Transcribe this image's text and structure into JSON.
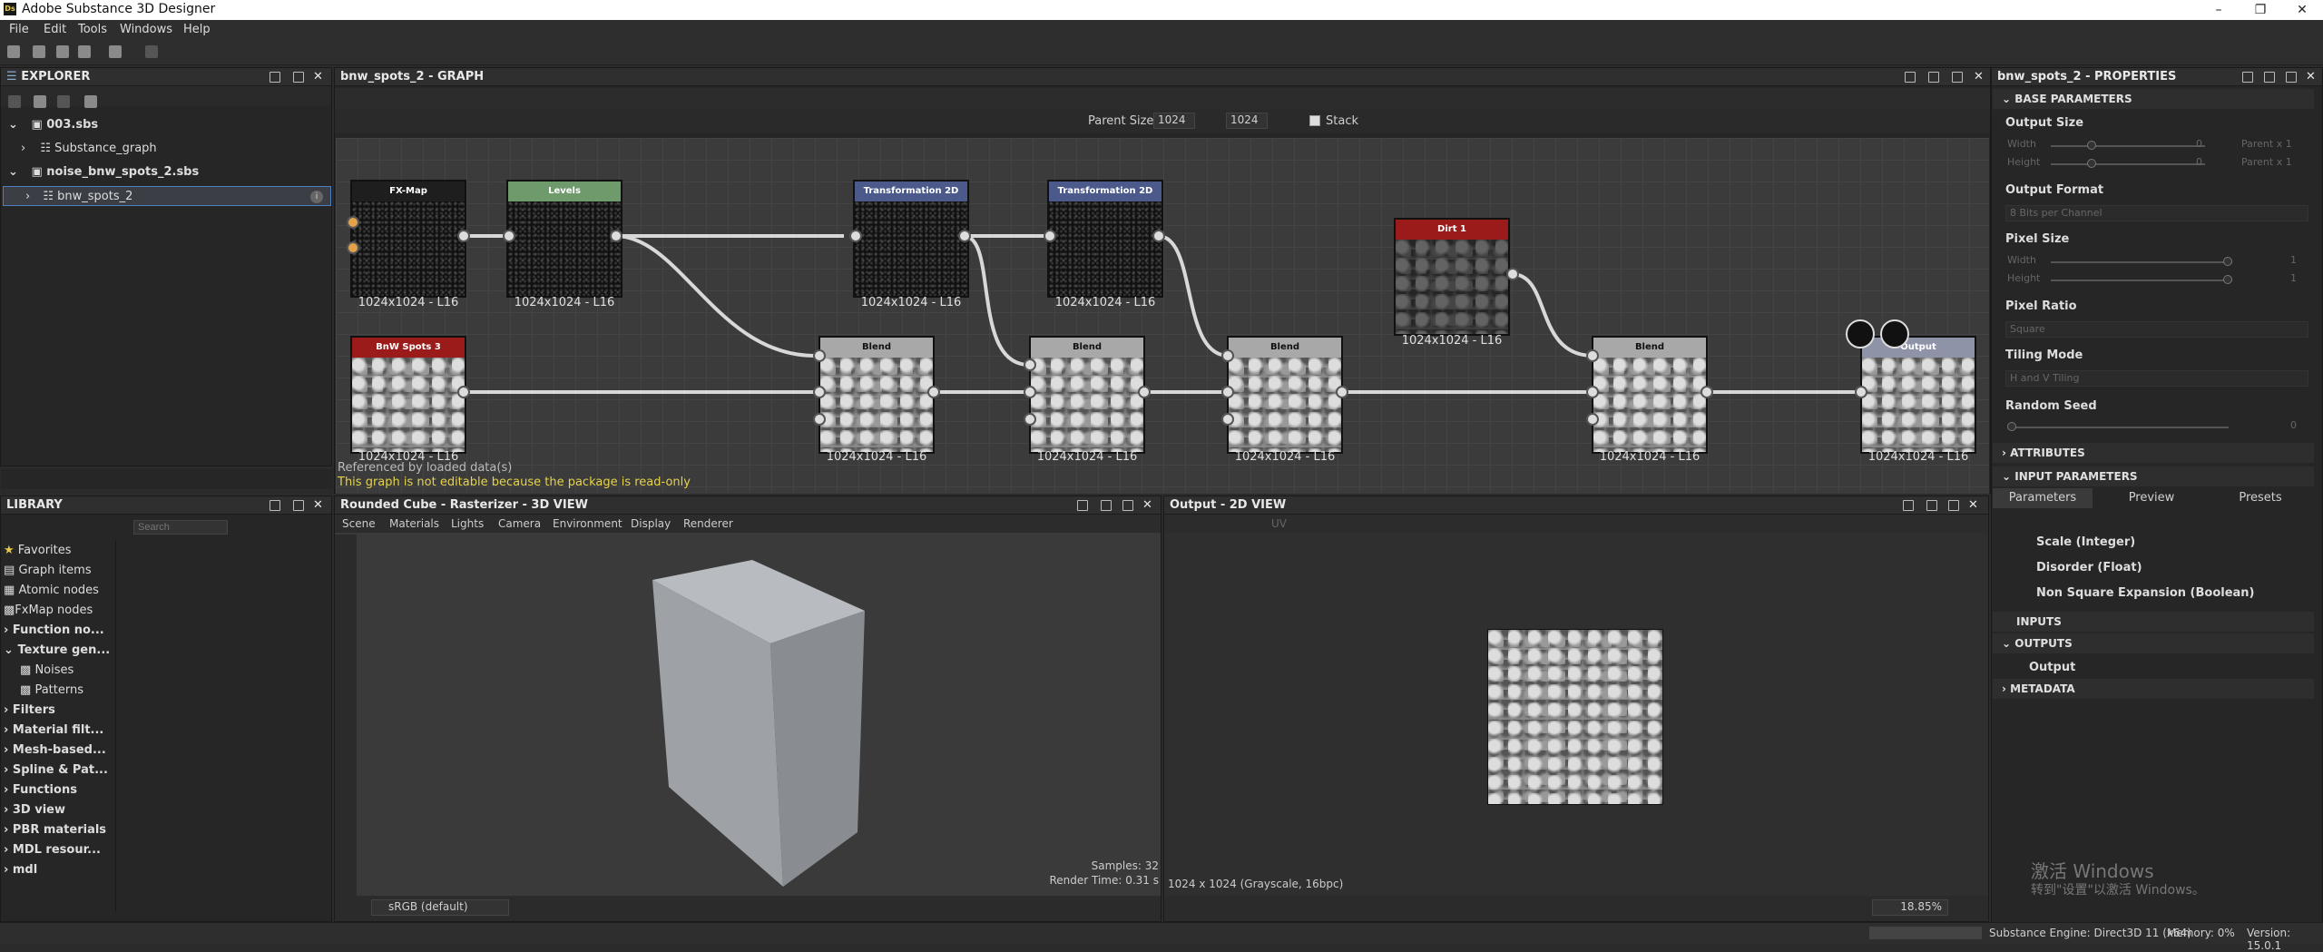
{
  "app": {
    "title": "Adobe Substance 3D Designer",
    "logo": "Ds"
  },
  "menu": [
    "File",
    "Edit",
    "Tools",
    "Windows",
    "Help"
  ],
  "explorer": {
    "title": "EXPLORER",
    "items": [
      {
        "label": "003.sbs"
      },
      {
        "label": "Substance_graph"
      },
      {
        "label": "noise_bnw_spots_2.sbs"
      },
      {
        "label": "bnw_spots_2"
      }
    ]
  },
  "graph": {
    "title": "bnw_spots_2 - GRAPH",
    "parent_size_label": "Parent Size:",
    "parent_size": "1024",
    "size2": "1024",
    "stack_label": "Stack",
    "nodes": [
      {
        "title": "FX-Map",
        "label": "1024x1024 - L16",
        "color": "#1e1e1e"
      },
      {
        "title": "Levels",
        "label": "1024x1024 - L16",
        "color": "#6f9a6c"
      },
      {
        "title": "Transformation 2D",
        "label": "1024x1024 - L16",
        "color": "#4b5a8a"
      },
      {
        "title": "Transformation 2D",
        "label": "1024x1024 - L16",
        "color": "#4b5a8a"
      },
      {
        "title": "Dirt 1",
        "label": "1024x1024 - L16",
        "color": "#9b1a1a"
      },
      {
        "title": "BnW Spots 3",
        "label": "1024x1024 - L16",
        "color": "#9b1a1a"
      },
      {
        "title": "Blend",
        "label": "1024x1024 - L16",
        "color": "#a8a8a8"
      },
      {
        "title": "Blend",
        "label": "1024x1024 - L16",
        "color": "#a8a8a8"
      },
      {
        "title": "Blend",
        "label": "1024x1024 - L16",
        "color": "#a8a8a8"
      },
      {
        "title": "Blend",
        "label": "1024x1024 - L16",
        "color": "#a8a8a8"
      },
      {
        "title": "Output",
        "label": "1024x1024 - L16",
        "color": "#a8a8a8"
      }
    ],
    "footer1": "Referenced by loaded data(s)",
    "footer2": "This graph is not editable because the package is read-only"
  },
  "properties": {
    "title": "bnw_spots_2 - PROPERTIES",
    "base": "BASE PARAMETERS",
    "output_size": "Output Size",
    "width": "Width",
    "height": "Height",
    "zero": "0",
    "parent_x1": "Parent x 1",
    "output_format": "Output Format",
    "format_value": "8 Bits per Channel",
    "pixel_size": "Pixel Size",
    "one": "1",
    "pixel_ratio": "Pixel Ratio",
    "ratio_value": "Square",
    "tiling_mode": "Tiling Mode",
    "tiling_value": "H and V Tiling",
    "random_seed": "Random Seed",
    "seed_value": "0",
    "attributes": "ATTRIBUTES",
    "input_params": "INPUT PARAMETERS",
    "tabs": [
      "Parameters",
      "Preview",
      "Presets"
    ],
    "params": [
      "Scale (Integer)",
      "Disorder (Float)",
      "Non Square Expansion (Boolean)"
    ],
    "inputs": "INPUTS",
    "outputs": "OUTPUTS",
    "output_item": "Output",
    "metadata": "METADATA",
    "watermark1": "激活 Windows",
    "watermark2": "转到\"设置\"以激活 Windows。"
  },
  "library": {
    "title": "LIBRARY",
    "search": "Search",
    "items": [
      "Favorites",
      "Graph items",
      "Atomic nodes",
      "FxMap nodes",
      "Function no...",
      "Texture gen...",
      "Noises",
      "Patterns",
      "Filters",
      "Material filt...",
      "Mesh-based...",
      "Spline & Pat...",
      "Functions",
      "3D view",
      "PBR materials",
      "MDL resour...",
      "mdl"
    ]
  },
  "view3d": {
    "title": "Rounded Cube - Rasterizer - 3D VIEW",
    "menu": [
      "Scene",
      "Materials",
      "Lights",
      "Camera",
      "Environment",
      "Display",
      "Renderer"
    ],
    "samples": "Samples: 32",
    "render_time": "Render Time: 0.31 s",
    "colorspace": "sRGB (default)"
  },
  "view2d": {
    "title": "Output - 2D VIEW",
    "uv": "UV",
    "info": "1024 x 1024 (Grayscale, 16bpc)",
    "zoom": "18.85%"
  },
  "status": {
    "engine": "Substance Engine: Direct3D 11 (x64)",
    "memory": "Memory: 0%",
    "version": "Version: 15.0.1"
  }
}
